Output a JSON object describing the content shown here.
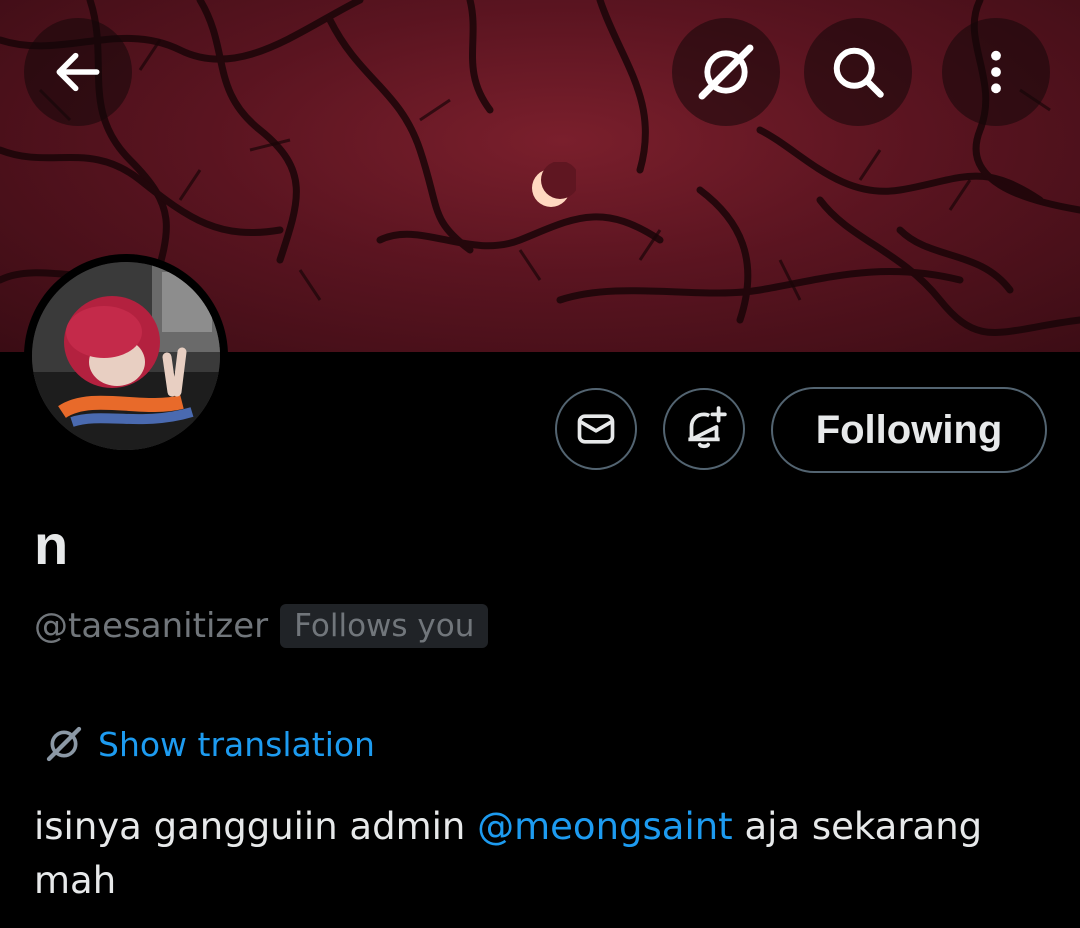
{
  "header": {
    "back_icon": "arrow-left-icon",
    "translate_icon": "translate-icon",
    "search_icon": "search-icon",
    "more_icon": "more-vertical-icon"
  },
  "profile": {
    "display_name": "n",
    "handle": "@taesanitizer",
    "follows_you_label": "Follows you",
    "show_translation_label": "Show translation",
    "bio": {
      "prefix": "isinya gangguiin admin ",
      "mention": "@meongsaint",
      "suffix": " aja sekarang mah"
    }
  },
  "actions": {
    "message_icon": "envelope-icon",
    "notify_icon": "bell-plus-icon",
    "following_label": "Following"
  },
  "colors": {
    "background": "#000000",
    "accent": "#1d9bf0",
    "text_primary": "#e7e9ea",
    "text_secondary": "#71767b",
    "border": "#536471",
    "banner": "#5a1420"
  }
}
